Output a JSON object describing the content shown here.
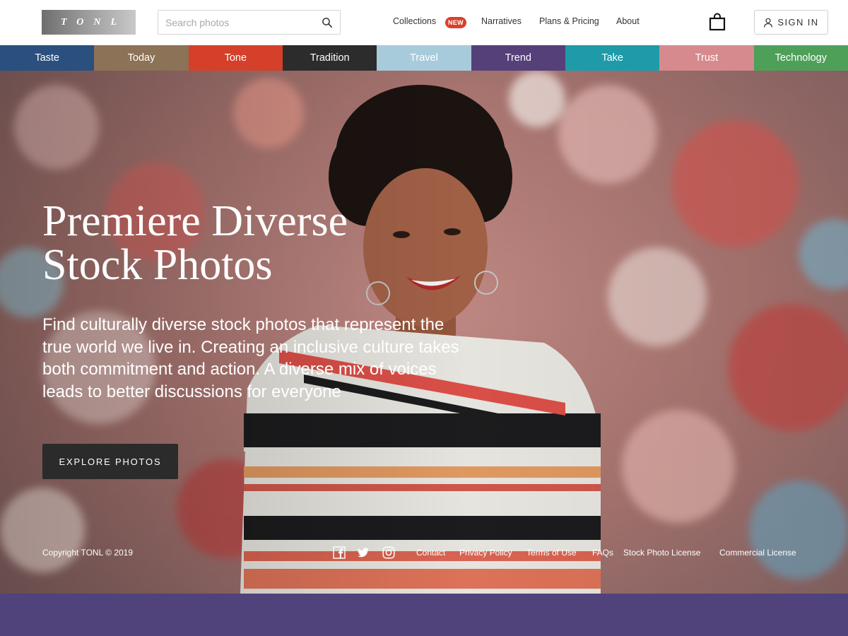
{
  "header": {
    "logo_text": "TONL",
    "search": {
      "placeholder": "Search photos"
    },
    "nav": {
      "collections": "Collections",
      "collections_badge": "NEW",
      "narratives": "Narratives",
      "plans": "Plans & Pricing",
      "about": "About"
    },
    "cart_icon": "shopping-bag-icon",
    "signin_label": "SIGN IN"
  },
  "categories": [
    {
      "label": "Taste",
      "color": "#2b4f7e"
    },
    {
      "label": "Today",
      "color": "#8c7256"
    },
    {
      "label": "Tone",
      "color": "#d4402a"
    },
    {
      "label": "Tradition",
      "color": "#2c2c2c"
    },
    {
      "label": "Travel",
      "color": "#a8cbdc"
    },
    {
      "label": "Trend",
      "color": "#55407a"
    },
    {
      "label": "Take",
      "color": "#1e9aa8"
    },
    {
      "label": "Trust",
      "color": "#d78a8e"
    },
    {
      "label": "Technology",
      "color": "#4ea059"
    }
  ],
  "hero": {
    "title_line1": "Premiere Diverse",
    "title_line2": "Stock Photos",
    "description": "Find culturally diverse stock photos that represent the true world we live in. Creating an inclusive culture takes both commitment and action. A diverse mix of voices leads to better discussions for everyone",
    "cta": "EXPLORE PHOTOS"
  },
  "footer": {
    "copyright": "Copyright TONL © 2019",
    "social": [
      "facebook-icon",
      "twitter-icon",
      "instagram-icon"
    ],
    "links": [
      "Contact",
      "Privacy Policy",
      "Terms of Use",
      "FAQs",
      "Stock Photo License",
      "Commercial License"
    ]
  },
  "colors": {
    "badge": "#d8402d",
    "cta_bg": "#2b2b2b",
    "footer_band": "#50427a"
  }
}
